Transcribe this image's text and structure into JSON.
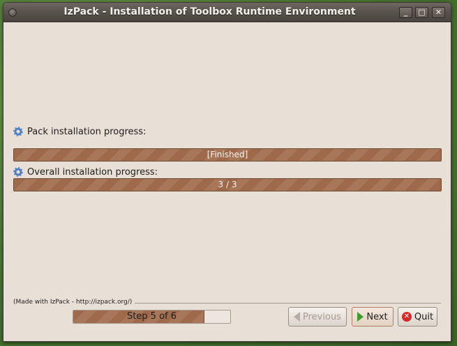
{
  "window": {
    "title": "IzPack - Installation of Toolbox Runtime Environment"
  },
  "window_controls": {
    "minimize": "_",
    "maximize": "□",
    "close": "✕"
  },
  "pack": {
    "label": "Pack installation progress:",
    "status": "[Finished]",
    "progress": 1.0
  },
  "overall": {
    "label": "Overall installation progress:",
    "status": "3 / 3",
    "progress": 1.0
  },
  "footer": {
    "credit": "(Made with IzPack - http://izpack.org/)",
    "step_text": "Step 5 of 6",
    "step_progress": 0.83
  },
  "buttons": {
    "previous": "Previous",
    "next": "Next",
    "quit": "Quit"
  },
  "icons": {
    "pack": "gear-icon",
    "overall": "gear-icon",
    "previous": "arrow-left-icon",
    "next": "arrow-right-icon",
    "quit": "quit-icon"
  }
}
